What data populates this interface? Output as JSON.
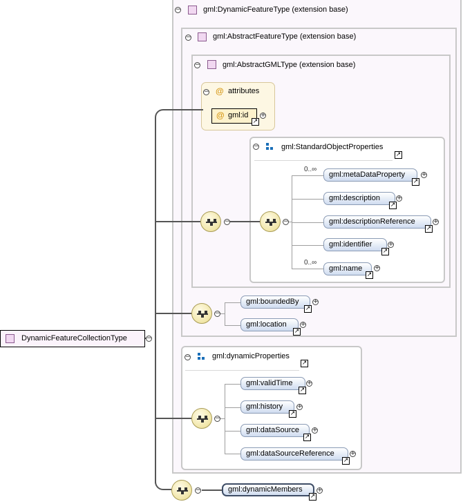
{
  "root": {
    "label": "DynamicFeatureCollectionType"
  },
  "extensions": {
    "dynamic_feature": "gml:DynamicFeatureType (extension base)",
    "abstract_feature": "gml:AbstractFeatureType (extension base)",
    "abstract_gml": "gml:AbstractGMLType (extension base)"
  },
  "attributes": {
    "title": "attributes",
    "id_label": "gml:id",
    "at_symbol": "@"
  },
  "standard_object_properties": {
    "title": "gml:StandardObjectProperties",
    "elements": [
      {
        "label": "gml:metaDataProperty",
        "occurs": "0..∞"
      },
      {
        "label": "gml:description",
        "occurs": ""
      },
      {
        "label": "gml:descriptionReference",
        "occurs": ""
      },
      {
        "label": "gml:identifier",
        "occurs": ""
      },
      {
        "label": "gml:name",
        "occurs": "0..∞"
      }
    ]
  },
  "feature_sequence": {
    "elements": [
      "gml:boundedBy",
      "gml:location"
    ]
  },
  "dynamic_properties": {
    "title": "gml:dynamicProperties",
    "elements": [
      "gml:validTime",
      "gml:history",
      "gml:dataSource",
      "gml:dataSourceReference"
    ]
  },
  "dynamic_members": {
    "label": "gml:dynamicMembers"
  },
  "symbols": {
    "minus": "−",
    "plus": "+",
    "ref_arrow": "↗"
  },
  "colors": {
    "element_fill": "#cfdcf0",
    "type_fill": "#f1d8f1",
    "sequence_fill": "#f1e6a8",
    "attributes_fill": "#fdf7e3"
  },
  "icons": [
    "type-square-icon",
    "sequence-icon",
    "group-icon",
    "attribute-icon",
    "reference-arrow-icon",
    "expand-icon",
    "collapse-icon"
  ]
}
